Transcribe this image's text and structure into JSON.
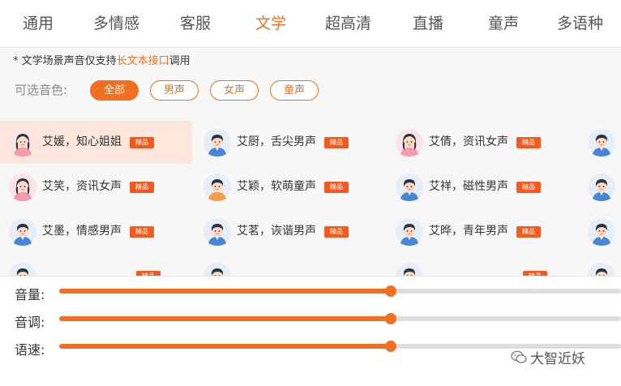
{
  "tabs": [
    "通用",
    "多情感",
    "客服",
    "文学",
    "超高清",
    "直播",
    "童声",
    "多语种"
  ],
  "active_tab": "文学",
  "note": {
    "prefix": "* 文学场景声音仅支持",
    "link": "长文本接口",
    "suffix": "调用"
  },
  "filter": {
    "label": "可选音色:",
    "options": [
      "全部",
      "男声",
      "女声",
      "童声"
    ],
    "selected": "全部"
  },
  "badge_label": "精品",
  "voices": [
    {
      "name": "艾媛，知心姐姐",
      "gender": "female",
      "badge": true,
      "selected": true
    },
    {
      "name": "艾厨，舌尖男声",
      "gender": "male",
      "badge": true
    },
    {
      "name": "艾倩，资讯女声",
      "gender": "female",
      "badge": true
    },
    {
      "name": "",
      "gender": "male",
      "badge": false
    },
    {
      "name": "艾笑，资讯女声",
      "gender": "female",
      "badge": true
    },
    {
      "name": "艾颖，软萌童声",
      "gender": "child",
      "badge": true
    },
    {
      "name": "艾祥，磁性男声",
      "gender": "male",
      "badge": true
    },
    {
      "name": "",
      "gender": "male",
      "badge": false
    },
    {
      "name": "艾墨，情感男声",
      "gender": "male",
      "badge": true
    },
    {
      "name": "艾茗，诙谐男声",
      "gender": "male",
      "badge": true
    },
    {
      "name": "艾晔，青年男声",
      "gender": "male",
      "badge": true
    },
    {
      "name": "",
      "gender": "male",
      "badge": false
    },
    {
      "name": "",
      "gender": "male",
      "badge": true
    },
    {
      "name": "",
      "gender": "male",
      "badge": false
    },
    {
      "name": "",
      "gender": "male",
      "badge": true
    },
    {
      "name": "",
      "gender": "male",
      "badge": false
    }
  ],
  "sliders": [
    {
      "label": "音量:",
      "value": 0.59
    },
    {
      "label": "音调:",
      "value": 0.59
    },
    {
      "label": "语速:",
      "value": 0.59
    }
  ],
  "colors": {
    "accent": "#f07020",
    "badge": "#f25b1d",
    "selected_bg": "#fde7dc"
  },
  "watermark": "大智近妖"
}
